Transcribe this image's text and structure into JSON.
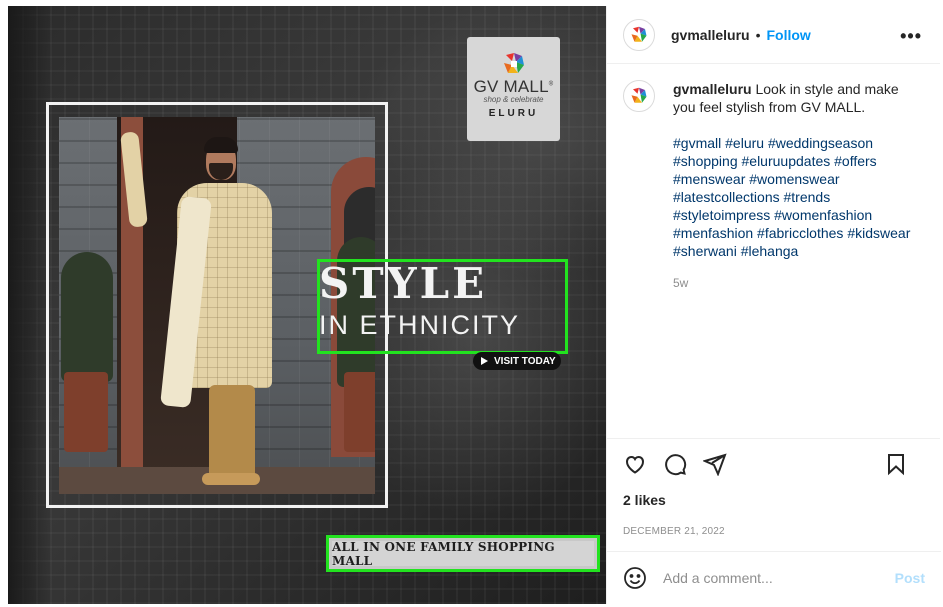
{
  "post": {
    "username": "gvmalleluru",
    "follow_label": "Follow",
    "separator": "•",
    "more_label": "•••",
    "caption": "Look in style and make you feel stylish from GV MALL.",
    "hashtags": "#gvmall #eluru #weddingseason #shopping #eluruupdates #offers #menswear #womenswear #latestcollections #trends #styletoimpress #womenfashion #menfashion #fabricclothes #kidswear #sherwani #lehanga",
    "age": "5w",
    "likes": "2 likes",
    "date": "DECEMBER 21, 2022",
    "comment_placeholder": "Add a comment...",
    "post_label": "Post"
  },
  "media": {
    "logo_title": "GV MALL",
    "logo_registered": "®",
    "logo_tagline": "shop & celebrate",
    "logo_city": "ELURU",
    "headline_line1": "STYLE",
    "headline_line2": "IN ETHNICITY",
    "cta": "VISIT TODAY",
    "banner": "ALL IN ONE FAMILY SHOPPING MALL"
  },
  "colors": {
    "accent_link": "#0095f6",
    "highlight": "#22e31f",
    "hashtag": "#00376b",
    "muted": "#8e8e8e",
    "post_disabled": "#b2dffc"
  },
  "icons": [
    "gv-logo-icon",
    "heart-icon",
    "comment-icon",
    "share-icon",
    "bookmark-icon",
    "emoji-icon",
    "more-icon",
    "play-icon"
  ]
}
